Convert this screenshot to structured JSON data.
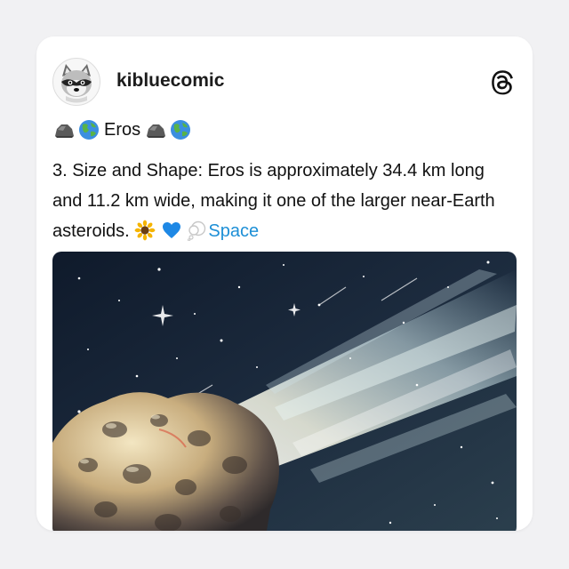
{
  "post": {
    "username": "kibluecomic",
    "title": {
      "text": "Eros",
      "leading_icons": [
        "rock-icon",
        "globe-icon"
      ],
      "trailing_icons": [
        "rock-icon",
        "globe-icon"
      ]
    },
    "caption": {
      "text": "3. Size and Shape: Eros is approximately 34.4 km long and 11.2 km wide, making it one of the larger near-Earth asteroids.",
      "trailing_icons": [
        "sunflower-icon",
        "blue-heart-icon",
        "thought-bubble-icon"
      ],
      "tag": "Space"
    },
    "image": {
      "subject": "asteroid-illustration"
    }
  },
  "colors": {
    "tag": "#1d8fd6",
    "text": "#111111",
    "card": "#ffffff",
    "background": "#f1f1f3"
  }
}
